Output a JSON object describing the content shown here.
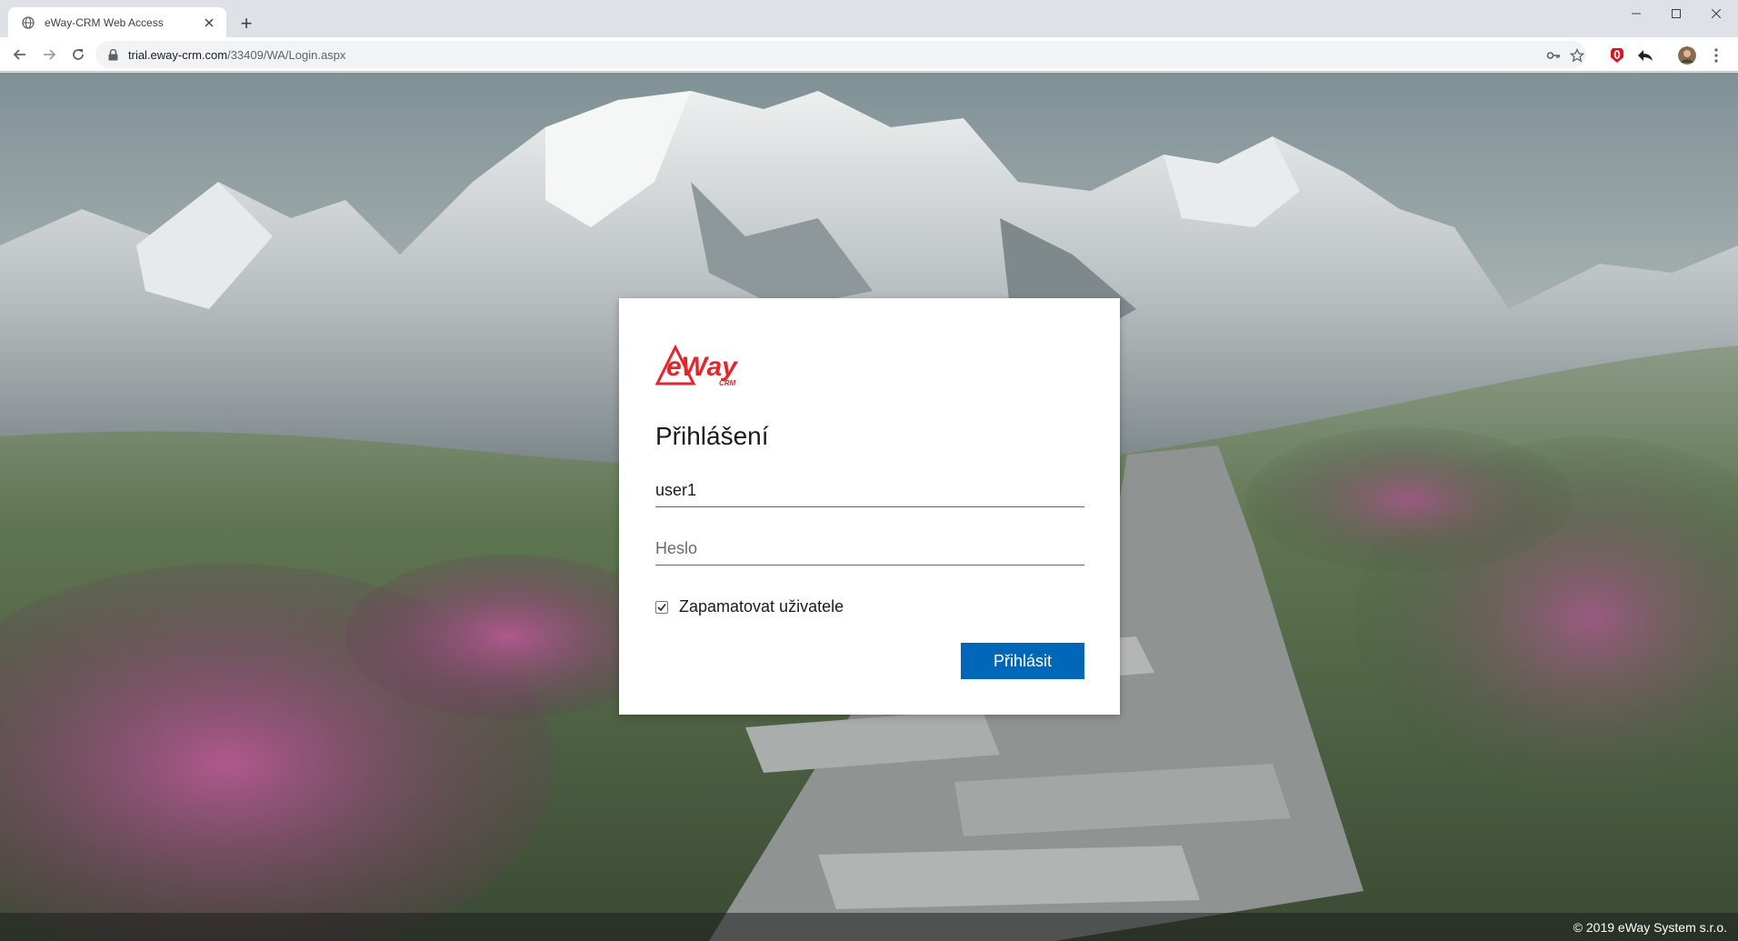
{
  "browser": {
    "tab_title": "eWay-CRM Web Access",
    "new_tab_label": "+",
    "url_host": "trial.eway-crm.com",
    "url_path": "/33409/WA/Login.aspx"
  },
  "login": {
    "logo_text": "eWay",
    "logo_sub": "CRM",
    "title": "Přihlášení",
    "username_value": "user1",
    "password_placeholder": "Heslo",
    "remember_label": "Zapamatovat uživatele",
    "remember_checked": true,
    "submit_label": "Přihlásit"
  },
  "footer": {
    "copyright": "© 2019 eWay System s.r.o."
  },
  "colors": {
    "brand_red": "#e3262b",
    "button_blue": "#0067b8"
  }
}
